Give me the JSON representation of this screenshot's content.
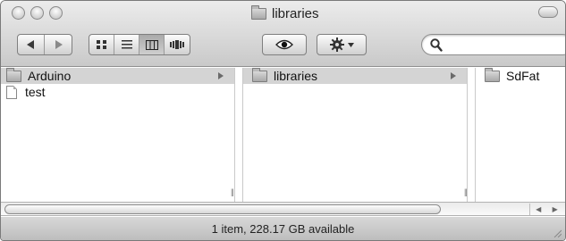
{
  "window": {
    "title": "libraries"
  },
  "toolbar": {
    "back_icon": "back-arrow-icon",
    "forward_icon": "forward-arrow-icon",
    "view_modes": [
      "icon-view",
      "list-view",
      "column-view",
      "cover-flow-view"
    ],
    "active_view": "column-view",
    "search": {
      "value": "",
      "placeholder": ""
    }
  },
  "columns": [
    {
      "items": [
        {
          "label": "Arduino",
          "type": "folder",
          "selected": true,
          "has_children": true
        },
        {
          "label": "test",
          "type": "file",
          "selected": false,
          "has_children": false
        }
      ]
    },
    {
      "items": [
        {
          "label": "libraries",
          "type": "folder",
          "selected": true,
          "has_children": true
        }
      ]
    },
    {
      "items": [
        {
          "label": "SdFat",
          "type": "folder",
          "selected": false,
          "has_children": false
        }
      ]
    }
  ],
  "status": {
    "text": "1 item, 228.17 GB available"
  }
}
